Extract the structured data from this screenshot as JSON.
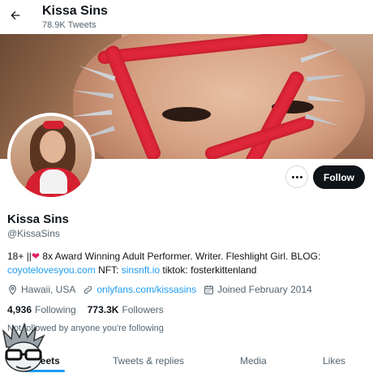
{
  "header": {
    "back_icon": "arrow-left-icon",
    "title": "Kissa Sins",
    "tweet_count": "78.9K Tweets"
  },
  "banner": {
    "description_icon": "banner-image"
  },
  "actions": {
    "more_icon": "more-horizontal-icon",
    "follow_label": "Follow"
  },
  "profile": {
    "display_name": "Kissa Sins",
    "handle": "@KissaSins",
    "bio_part1": "18+ ||",
    "bio_heart": "❤",
    "bio_part2": " 8x Award Winning Adult Performer. Writer. Fleshlight Girl. BLOG:",
    "bio_link1": "coyotelovesyou.com",
    "bio_part3": " NFT: ",
    "bio_link2": "sinsnft.io",
    "bio_part4": " tiktok: fosterkittenland",
    "location": "Hawaii, USA",
    "website": "onlyfans.com/kissasins",
    "joined": "Joined February 2014",
    "following_count": "4,936",
    "following_label": "Following",
    "followers_count": "773.3K",
    "followers_label": "Followers",
    "not_followed": "Not followed by anyone you're following"
  },
  "tabs": [
    {
      "label": "Tweets",
      "active": true
    },
    {
      "label": "Tweets & replies",
      "active": false
    },
    {
      "label": "Media",
      "active": false
    },
    {
      "label": "Likes",
      "active": false
    }
  ],
  "colors": {
    "accent": "#1d9bf0",
    "text": "#0f1419",
    "muted": "#536471",
    "follow_button": "#0f1419"
  }
}
